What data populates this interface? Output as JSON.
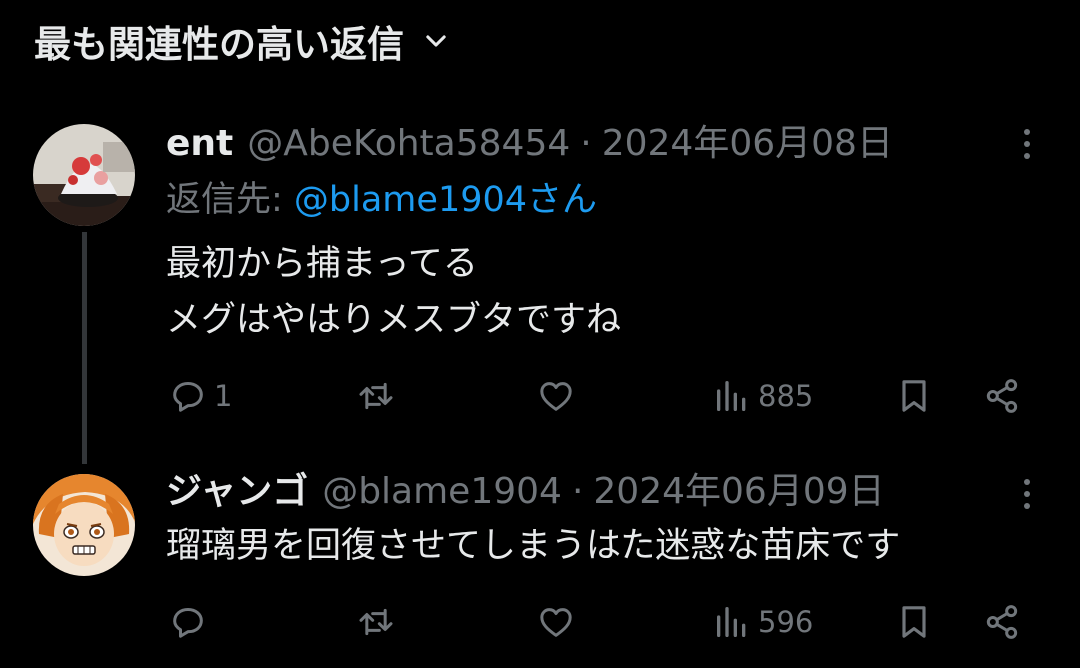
{
  "header": {
    "sort_label": "最も関連性の高い返信"
  },
  "tweets": [
    {
      "display_name": "ent",
      "handle": "@AbeKohta58454",
      "separator": "·",
      "date": "2024年06月08日",
      "reply_to_prefix": "返信先: ",
      "reply_to_mention": "@blame1904さん",
      "text_lines": [
        "最初から捕まってる",
        "メグはやはりメスブタですね"
      ],
      "replies": "1",
      "retweets": "",
      "likes": "",
      "views": "885"
    },
    {
      "display_name": "ジャンゴ",
      "handle": "@blame1904",
      "separator": "·",
      "date": "2024年06月09日",
      "text_lines": [
        "瑠璃男を回復させてしまうはた迷惑な苗床です"
      ],
      "replies": "",
      "retweets": "",
      "likes": "",
      "views": "596"
    }
  ],
  "colors": {
    "background": "#000000",
    "primary_text": "#e7e9ea",
    "secondary_text": "#71767b",
    "link": "#1d9bf0",
    "thread_line": "#333639"
  },
  "icons": [
    "chevron-down-icon",
    "more-icon",
    "reply-icon",
    "retweet-icon",
    "like-icon",
    "views-icon",
    "bookmark-icon",
    "share-icon"
  ]
}
